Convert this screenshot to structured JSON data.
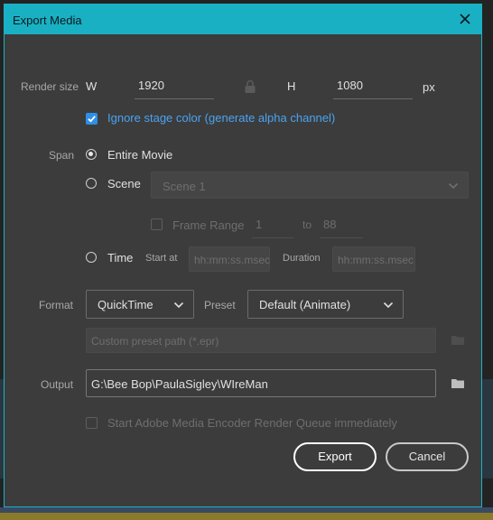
{
  "dialog": {
    "title": "Export Media",
    "render_size": {
      "label": "Render size",
      "width_label": "W",
      "width_value": "1920",
      "height_label": "H",
      "height_value": "1080",
      "unit": "px",
      "lock_icon": "lock-icon"
    },
    "ignore_stage": {
      "label": "Ignore stage color (generate alpha channel)",
      "checked": true
    },
    "span": {
      "label": "Span",
      "entire_movie": "Entire Movie",
      "scene": "Scene",
      "scene_value": "Scene 1",
      "frame_range": "Frame Range",
      "frame_from": "1",
      "frame_to_label": "to",
      "frame_to": "88",
      "time": "Time",
      "start_at_label": "Start at",
      "start_at_placeholder": "hh:mm:ss.msec",
      "duration_label": "Duration",
      "duration_placeholder": "hh:mm:ss.msec",
      "selected": "Entire Movie"
    },
    "format": {
      "label": "Format",
      "value": "QuickTime",
      "preset_label": "Preset",
      "preset_value": "Default (Animate)",
      "custom_preset_placeholder": "Custom preset path (*.epr)"
    },
    "output": {
      "label": "Output",
      "value": "G:\\Bee Bop\\PaulaSigley\\WIreMan"
    },
    "queue": {
      "label": "Start Adobe Media Encoder Render Queue immediately",
      "checked": false
    },
    "buttons": {
      "export": "Export",
      "cancel": "Cancel"
    }
  },
  "colors": {
    "accent": "#1ab0c4",
    "checkbox": "#2f8fe8",
    "link_text": "#4aa3f0"
  }
}
